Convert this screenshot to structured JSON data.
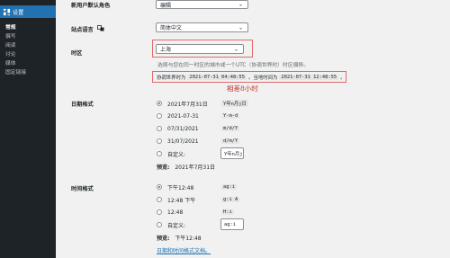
{
  "sidebar": {
    "header": "设置",
    "items": [
      "常规",
      "撰写",
      "阅读",
      "讨论",
      "媒体",
      "固定链接"
    ]
  },
  "new_user_role": {
    "label": "新用户默认角色",
    "value": "编辑"
  },
  "site_language": {
    "label": "站点语言",
    "value": "简体中文"
  },
  "timezone": {
    "label": "时区",
    "value": "上海",
    "description": "选择与您在同一时区的城市或一个UTC（协调世界时）时区偏移。",
    "utc_prefix": "协调世界时为",
    "utc_time": "2021-07-31 04:48:55",
    "local_prefix": "。当地时间为",
    "local_time": "2021-07-31 12:48:55",
    "suffix": "。",
    "note": "相差8小时"
  },
  "date_format": {
    "label": "日期格式",
    "options": [
      {
        "label": "2021年7月31日",
        "code": "Y年n月j日",
        "checked": true
      },
      {
        "label": "2021-07-31",
        "code": "Y-m-d",
        "checked": false
      },
      {
        "label": "07/31/2021",
        "code": "m/d/Y",
        "checked": false
      },
      {
        "label": "31/07/2021",
        "code": "d/m/Y",
        "checked": false
      }
    ],
    "custom_label": "自定义:",
    "custom_value": "Y年n月j",
    "preview_label": "预览:",
    "preview_value": "2021年7月31日"
  },
  "time_format": {
    "label": "时间格式",
    "options": [
      {
        "label": "下午12:48",
        "code": "ag:i",
        "checked": true
      },
      {
        "label": "12:48 下午",
        "code": "g:i A",
        "checked": false
      },
      {
        "label": "12:48",
        "code": "H:i",
        "checked": false
      }
    ],
    "custom_label": "自定义:",
    "custom_value": "ag:i",
    "preview_label": "预览:",
    "preview_value": "下午12:48",
    "doc_link": "日期和时间格式文档。"
  },
  "colors": {
    "accent": "#2271b1",
    "sidebar": "#1d2327",
    "highlight": "#e06a6a",
    "note": "#c0302a"
  }
}
